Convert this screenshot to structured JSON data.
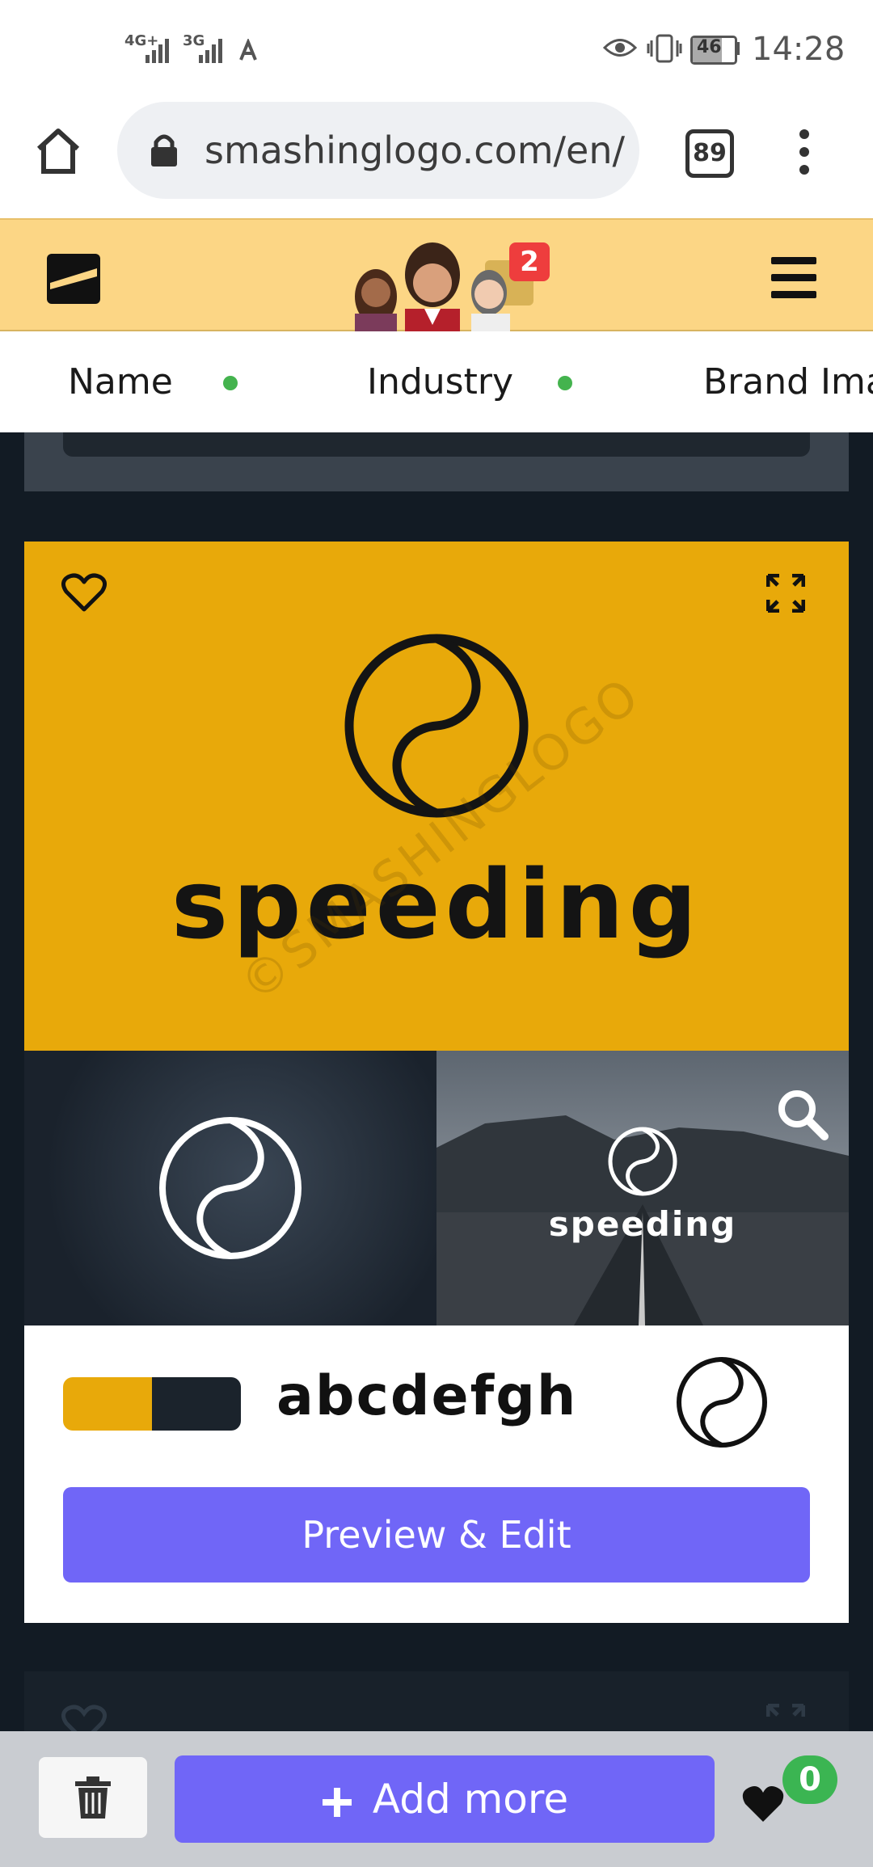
{
  "status_bar": {
    "signal_1_label": "4G+",
    "signal_2_label": "3G",
    "battery": "46",
    "time": "14:28"
  },
  "browser": {
    "url": "smashinglogo.com/en/lc",
    "tab_count": "89"
  },
  "header": {
    "notification_count": "2"
  },
  "filters": {
    "items": [
      {
        "label": "Name"
      },
      {
        "label": "Industry"
      },
      {
        "label": "Brand Ima"
      }
    ]
  },
  "logo": {
    "brand_name": "speeding",
    "watermark": "©SMASHINGLOGO",
    "font_sample": "abcdefgh",
    "colors": [
      "#e8a90a",
      "#1b232c"
    ]
  },
  "actions": {
    "preview_edit": "Preview & Edit",
    "add_more": "Add more",
    "favorites_count": "0"
  }
}
